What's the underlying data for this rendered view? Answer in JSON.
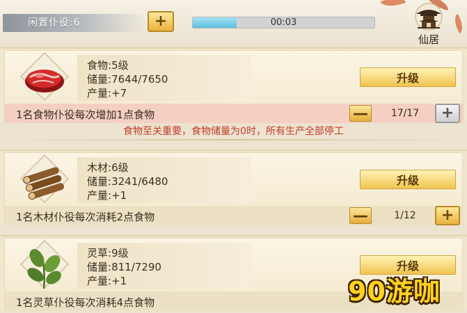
{
  "topbar": {
    "idle_workers": "闲置仆役:6",
    "add_worker_symbol": "+",
    "timer": "00:03",
    "timer_progress": 0.24,
    "residence_label": "仙居"
  },
  "food": {
    "icon": "raw-meat-icon",
    "level": "5级",
    "level_label": "食物:",
    "storage_label": "储量:",
    "storage": "7644/7650",
    "output_label": "产量:",
    "output": "+7",
    "upgrade_label": "升级",
    "worker_desc": "1名食物仆役每次增加1点食物",
    "minus_symbol": "—",
    "workers": "17/17",
    "plus_symbol": "+"
  },
  "warning": "食物至关重要，食物储量为0时，所有生产全部停工",
  "wood": {
    "icon": "log-pile-icon",
    "level_label": "木材:",
    "level": "6级",
    "storage_label": "储量:",
    "storage": "3241/6480",
    "output_label": "产量:",
    "output": "+1",
    "upgrade_label": "升级",
    "worker_desc": "1名木材仆役每次消耗2点食物",
    "minus_symbol": "—",
    "workers": "1/12",
    "plus_symbol": "+"
  },
  "herb": {
    "icon": "herb-leaf-icon",
    "level_label": "灵草:",
    "level": "9级",
    "storage_label": "储量:",
    "storage": "811/7290",
    "output_label": "产量:",
    "output": "+1",
    "upgrade_label": "升级",
    "worker_desc": "1名灵草仆役每次消耗4点食物"
  },
  "watermark": "90游咖",
  "colors": {
    "button_gold": "#f0c450",
    "warning_red": "#c43b2a",
    "timer_blue": "#5cbfe0",
    "food_row": "#f4cfc2"
  }
}
